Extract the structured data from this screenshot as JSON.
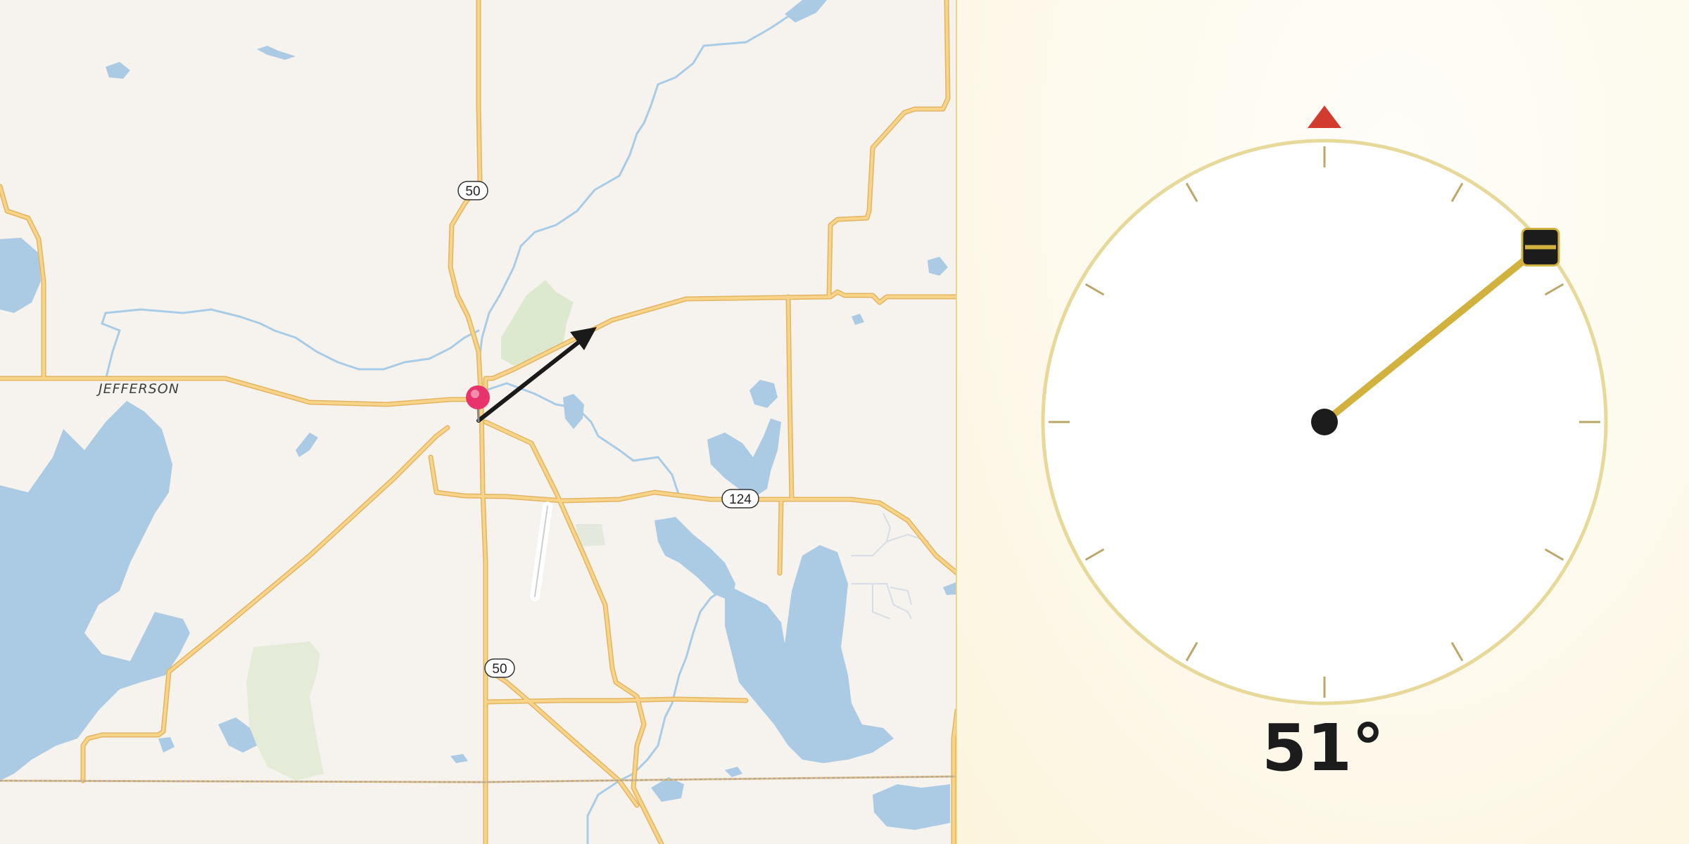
{
  "map": {
    "place_label": "JEFFERSON",
    "route_shields": [
      "50",
      "50",
      "124"
    ],
    "colors": {
      "land": "#f6f3ef",
      "water": "#aacbe3",
      "road": "#f2c66e",
      "road_casing": "#e1b45c",
      "park": "#dde9cf",
      "pin": "#e8336c",
      "arrow": "#1a1a1a"
    },
    "icons": [
      "location-pin-icon",
      "heading-arrow-icon"
    ]
  },
  "compass": {
    "heading_value": "51°",
    "heading_degrees": 51,
    "tick_count": 12,
    "colors": {
      "dial_face": "#ffffff",
      "dial_ring": "#e6d999",
      "ticks": "#b9a86a",
      "needle": "#d2b23e",
      "hub": "#1c1c1c",
      "north_marker": "#d23b2e"
    },
    "icons": [
      "north-marker-icon",
      "needle-handle-icon"
    ]
  }
}
